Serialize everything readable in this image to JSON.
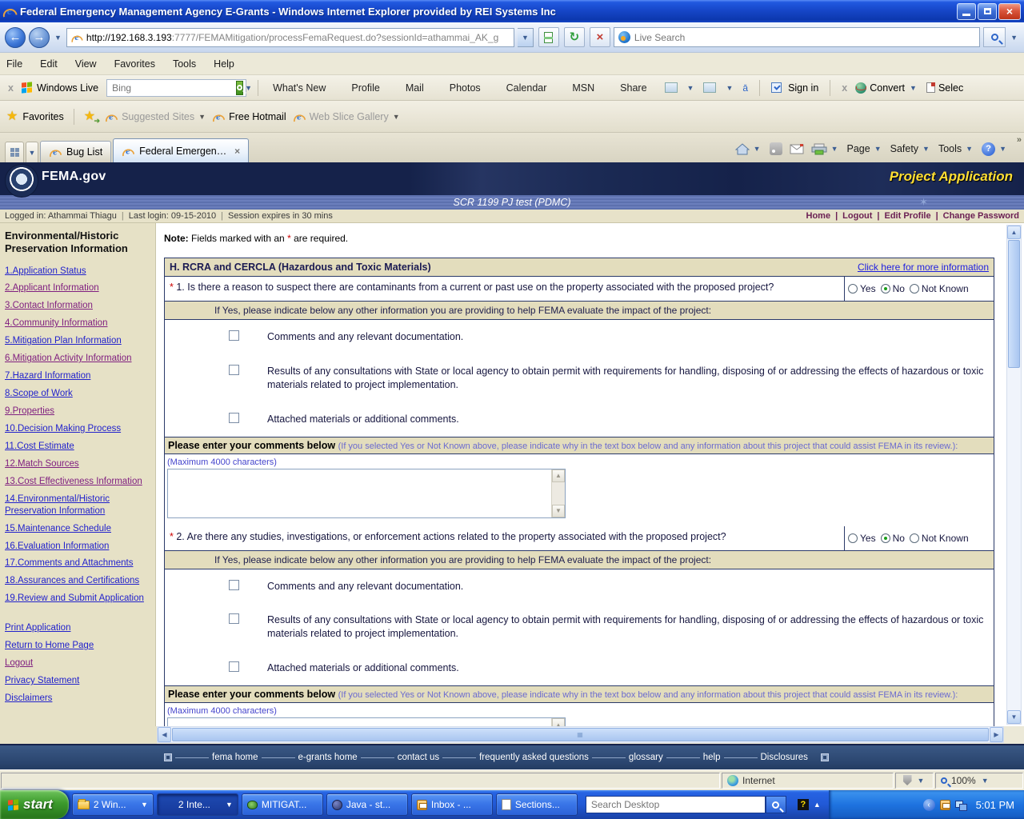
{
  "window": {
    "title": "Federal Emergency Management Agency E-Grants - Windows Internet Explorer provided by REI Systems Inc"
  },
  "address_bar": {
    "url_protocol": "http://",
    "url_host": "192.168.3.193",
    "url_rest": ":7777/FEMAMitigation/processFemaRequest.do?sessionId=athammai_AK_g",
    "search_placeholder": "Live Search"
  },
  "menu_bar": [
    "File",
    "Edit",
    "View",
    "Favorites",
    "Tools",
    "Help"
  ],
  "live_toolbar": {
    "brand": "Windows Live",
    "search_placeholder": "Bing",
    "links": [
      "What's New",
      "Profile",
      "Mail",
      "Photos",
      "Calendar",
      "MSN",
      "Share"
    ],
    "sign_in": "Sign in",
    "convert_label": "Convert",
    "select_label": "Selec"
  },
  "favorites_bar": {
    "favorites_label": "Favorites",
    "items": [
      {
        "label": "Suggested Sites",
        "cls": "muted",
        "arrow": "has-arrow"
      },
      {
        "label": "Free Hotmail",
        "cls": "plain",
        "arrow": "no-arrow"
      },
      {
        "label": "Web Slice Gallery",
        "cls": "muted",
        "arrow": "has-arrow"
      }
    ]
  },
  "tab_bar": {
    "tabs": [
      {
        "label": "Bug List",
        "state": "plain"
      },
      {
        "label": "Federal Emergenc...",
        "state": "active"
      }
    ],
    "command": {
      "page": "Page",
      "safety": "Safety",
      "tools": "Tools"
    }
  },
  "site_header": {
    "brand": "FEMA.gov",
    "page_title": "Project Application",
    "subtitle": "SCR 1199 PJ test (PDMC)"
  },
  "session_bar": {
    "items": [
      "Logged in: Athammai Thiagu",
      "Last login: 09-15-2010",
      "Session expires in 30 mins"
    ],
    "links": [
      "Home",
      "Logout",
      "Edit Profile",
      "Change Password"
    ]
  },
  "sidebar": {
    "title": "Environmental/Historic Preservation Information",
    "items": [
      {
        "label": "1.Application Status",
        "state": "plain"
      },
      {
        "label": "2.Applicant Information",
        "state": "visited"
      },
      {
        "label": "3.Contact Information",
        "state": "visited"
      },
      {
        "label": "4.Community Information",
        "state": "visited"
      },
      {
        "label": "5.Mitigation Plan Information",
        "state": "plain"
      },
      {
        "label": "6.Mitigation Activity Information",
        "state": "visited"
      },
      {
        "label": "7.Hazard Information",
        "state": "plain"
      },
      {
        "label": "8.Scope of Work",
        "state": "plain"
      },
      {
        "label": "9.Properties",
        "state": "visited"
      },
      {
        "label": "10.Decision Making Process",
        "state": "plain"
      },
      {
        "label": "11.Cost Estimate",
        "state": "plain"
      },
      {
        "label": "12.Match Sources",
        "state": "visited"
      },
      {
        "label": "13.Cost Effectiveness Information",
        "state": "visited"
      },
      {
        "label": "14.Environmental/Historic Preservation Information",
        "state": "plain"
      },
      {
        "label": "15.Maintenance Schedule",
        "state": "plain"
      },
      {
        "label": "16.Evaluation Information",
        "state": "plain"
      },
      {
        "label": "17.Comments and Attachments",
        "state": "plain"
      },
      {
        "label": "18.Assurances and Certifications",
        "state": "plain"
      },
      {
        "label": "19.Review and Submit Application",
        "state": "plain"
      }
    ],
    "extra_links": [
      {
        "label": "Print Application",
        "state": "plain"
      },
      {
        "label": "Return to Home Page",
        "state": "plain"
      },
      {
        "label": "Logout",
        "state": "visited"
      },
      {
        "label": "Privacy Statement",
        "state": "plain"
      },
      {
        "label": "Disclaimers",
        "state": "plain"
      }
    ]
  },
  "main": {
    "note": {
      "label": "Note:",
      "pre": "Fields marked with an",
      "star": "*",
      "post": "are required."
    },
    "section_header": {
      "title": "H. RCRA and CERCLA (Hazardous and Toxic Materials)",
      "link": "Click here for more information"
    },
    "if_yes_text": "If Yes, please indicate below any other information you are providing to help FEMA evaluate the impact of the project:",
    "checkbox_items": [
      {
        "label": "Comments and any relevant documentation."
      },
      {
        "label": "Results of any consultations with State or local agency to obtain permit with requirements for handling, disposing of or addressing the effects of hazardous or toxic materials related to project implementation."
      },
      {
        "label": "Attached materials or additional comments."
      }
    ],
    "comments_title": "Please enter your comments below",
    "comments_note": "(If you selected Yes or Not Known above, please indicate why in the text box below and any information about this project that could assist FEMA in its review.):",
    "max_chars": "(Maximum 4000 characters)",
    "questions": [
      {
        "star": "*",
        "num": "1.",
        "text": "Is there a reason to suspect there are contaminants from a current or past use on the property associated with the proposed project?",
        "options": [
          {
            "label": "Yes",
            "state": "plain"
          },
          {
            "label": "No",
            "state": "checked"
          },
          {
            "label": "Not Known",
            "state": "plain"
          }
        ]
      },
      {
        "star": "*",
        "num": "2.",
        "text": "Are there any studies, investigations, or enforcement actions related to the property associated with the proposed project?",
        "options": [
          {
            "label": "Yes",
            "state": "plain"
          },
          {
            "label": "No",
            "state": "checked"
          },
          {
            "label": "Not Known",
            "state": "plain"
          }
        ]
      }
    ]
  },
  "footer": {
    "links": [
      "fema home",
      "e-grants home",
      "contact us",
      "frequently asked questions",
      "glossary",
      "help",
      "Disclosures"
    ]
  },
  "status_bar": {
    "zone": "Internet",
    "zoom": "100%"
  },
  "taskbar": {
    "start_label": "start",
    "tasks": [
      {
        "label": "2 Win...",
        "icon": "folder-icon",
        "state": "plain",
        "arrow": "has-arrow"
      },
      {
        "label": "2 Inte...",
        "icon": "ie-task",
        "state": "active",
        "arrow": "has-arrow"
      },
      {
        "label": "MITIGAT...",
        "icon": "frog-icon",
        "state": "plain",
        "arrow": "no-arrow"
      },
      {
        "label": "Java - st...",
        "icon": "java-icon",
        "state": "plain",
        "arrow": "no-arrow"
      },
      {
        "label": "Inbox - ...",
        "icon": "outlook-icon",
        "state": "plain",
        "arrow": "no-arrow"
      },
      {
        "label": "Sections...",
        "icon": "word-icon",
        "state": "plain",
        "arrow": "no-arrow"
      }
    ],
    "search_placeholder": "Search Desktop",
    "clock": "5:01 PM"
  },
  "colors": {
    "titlebar_blue": "#1747C9",
    "toolbar_tan": "#ECE9D8",
    "header_navy": "#15224A",
    "band_blue": "#6275B5",
    "panel_tan": "#E6E1C6",
    "section_tan": "#E3DDBD",
    "table_border_navy": "#2B3A69",
    "link_blue": "#2222CC",
    "link_visited": "#802080",
    "accent_yellow": "#FFDE33",
    "session_link_maroon": "#6B2053",
    "required_red": "#CC0000",
    "radio_green": "#1A9E1A",
    "footer_navy": "#2B4670",
    "taskbar_blue": "#2159D6",
    "start_green": "#3C9A2C"
  }
}
